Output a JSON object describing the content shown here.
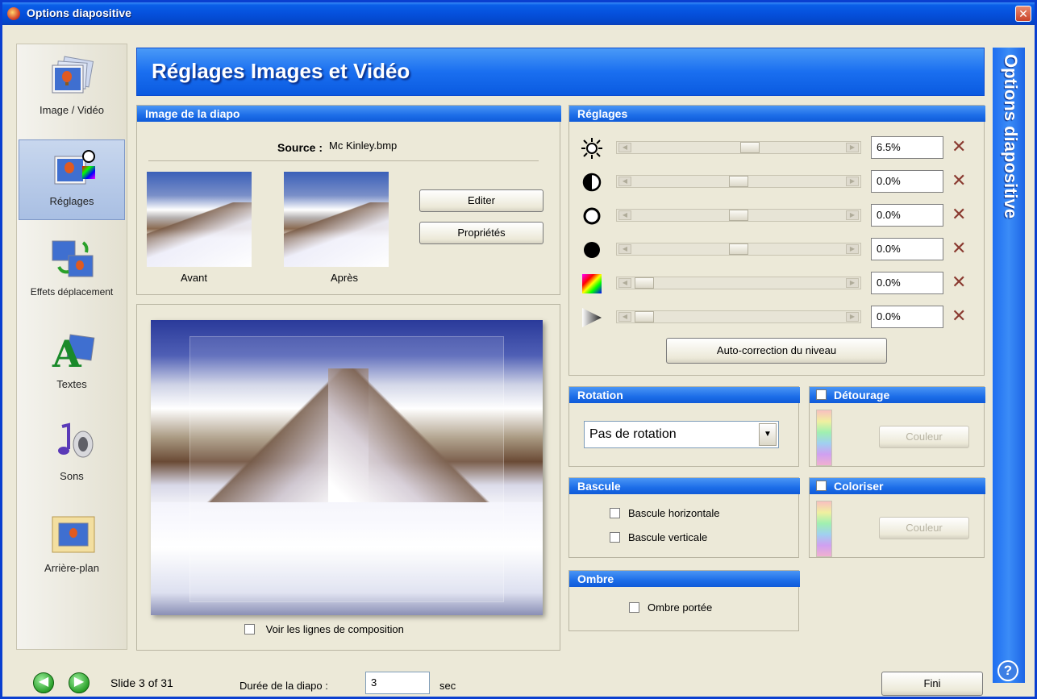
{
  "window": {
    "title": "Options diapositive",
    "close_glyph": "✕"
  },
  "header": {
    "title": "Réglages Images et Vidéo"
  },
  "vbanner": {
    "text": "Options diapositive",
    "help_glyph": "?"
  },
  "sidebar": {
    "items": [
      {
        "label": "Image / Vidéo",
        "icon": "photos-icon"
      },
      {
        "label": "Réglages",
        "icon": "adjust-icon",
        "active": true
      },
      {
        "label": "Effets déplacement",
        "icon": "motion-icon"
      },
      {
        "label": "Textes",
        "icon": "text-icon"
      },
      {
        "label": "Sons",
        "icon": "sound-icon"
      },
      {
        "label": "Arrière-plan",
        "icon": "background-icon"
      }
    ]
  },
  "image_panel": {
    "heading": "Image de la diapo",
    "source_label": "Source :",
    "source_value": "Mc Kinley.bmp",
    "before_label": "Avant",
    "after_label": "Après",
    "edit_button": "Editer",
    "props_button": "Propriétés"
  },
  "composition": {
    "label": "Voir les lignes de composition"
  },
  "settings": {
    "heading": "Réglages",
    "sliders": [
      {
        "icon": "brightness-icon",
        "value": "6.5%",
        "level": 0.56
      },
      {
        "icon": "contrast-icon",
        "value": "0.0%",
        "level": 0.5
      },
      {
        "icon": "white-level-icon",
        "value": "0.0%",
        "level": 0.5
      },
      {
        "icon": "black-level-icon",
        "value": "0.0%",
        "level": 0.5
      },
      {
        "icon": "color-icon",
        "value": "0.0%",
        "level": 0.0
      },
      {
        "icon": "sharpness-icon",
        "value": "0.0%",
        "level": 0.0
      }
    ],
    "auto_button": "Auto-correction du niveau"
  },
  "rotation": {
    "heading": "Rotation",
    "selected": "Pas de rotation"
  },
  "bascule": {
    "heading": "Bascule",
    "horizontal": "Bascule horizontale",
    "vertical": "Bascule verticale"
  },
  "ombre": {
    "heading": "Ombre",
    "label": "Ombre portée"
  },
  "detourage": {
    "heading": "Détourage",
    "button": "Couleur"
  },
  "coloriser": {
    "heading": "Coloriser",
    "button": "Couleur"
  },
  "footer": {
    "slide_info": "Slide 3 of 31",
    "duration_label": "Durée de la diapo :",
    "duration_value": "3",
    "duration_unit": "sec",
    "finish_button": "Fini"
  }
}
